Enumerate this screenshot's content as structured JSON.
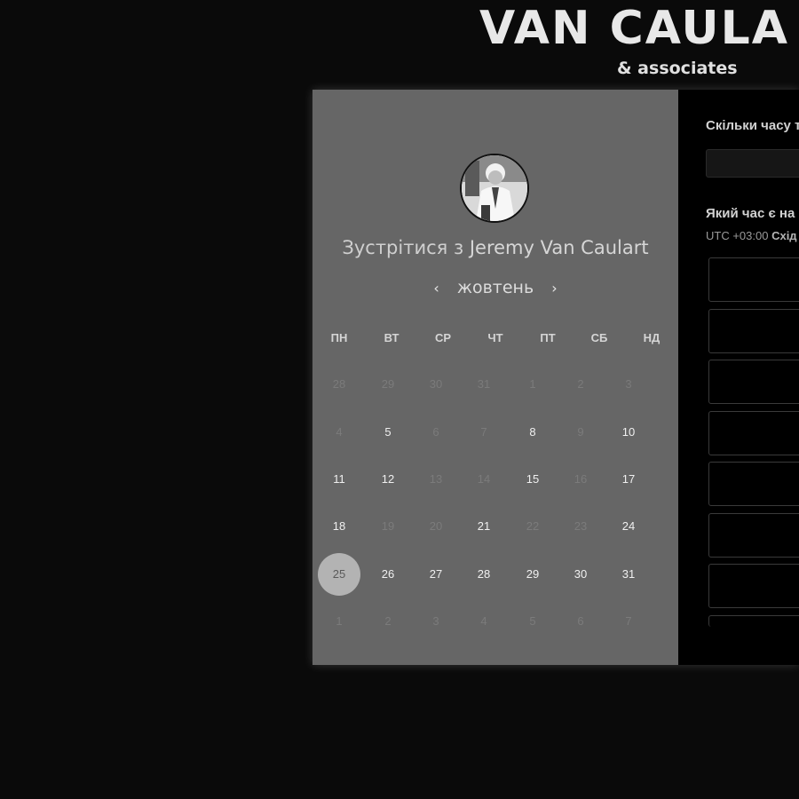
{
  "brand": {
    "name": "VAN CAULA",
    "sub": "& associates"
  },
  "booking": {
    "title_prefix": "Зустрітися з",
    "host_name": "Jeremy Van Caulart",
    "month": "жовтень",
    "prev_icon": "‹",
    "next_icon": "›",
    "weekdays": [
      "ПН",
      "ВТ",
      "СР",
      "ЧТ",
      "ПТ",
      "СБ",
      "НД"
    ],
    "weeks": [
      [
        {
          "d": "28",
          "a": false
        },
        {
          "d": "29",
          "a": false
        },
        {
          "d": "30",
          "a": false
        },
        {
          "d": "31",
          "a": false
        },
        {
          "d": "1",
          "a": false
        },
        {
          "d": "2",
          "a": false
        },
        {
          "d": "3",
          "a": false
        }
      ],
      [
        {
          "d": "4",
          "a": false
        },
        {
          "d": "5",
          "a": true
        },
        {
          "d": "6",
          "a": false
        },
        {
          "d": "7",
          "a": false
        },
        {
          "d": "8",
          "a": true
        },
        {
          "d": "9",
          "a": false
        },
        {
          "d": "10",
          "a": true
        }
      ],
      [
        {
          "d": "11",
          "a": true
        },
        {
          "d": "12",
          "a": true
        },
        {
          "d": "13",
          "a": false
        },
        {
          "d": "14",
          "a": false
        },
        {
          "d": "15",
          "a": true
        },
        {
          "d": "16",
          "a": false
        },
        {
          "d": "17",
          "a": true
        }
      ],
      [
        {
          "d": "18",
          "a": true
        },
        {
          "d": "19",
          "a": false
        },
        {
          "d": "20",
          "a": false
        },
        {
          "d": "21",
          "a": true
        },
        {
          "d": "22",
          "a": false
        },
        {
          "d": "23",
          "a": false
        },
        {
          "d": "24",
          "a": true
        }
      ],
      [
        {
          "d": "25",
          "a": true,
          "selected": true
        },
        {
          "d": "26",
          "a": true
        },
        {
          "d": "27",
          "a": true
        },
        {
          "d": "28",
          "a": true
        },
        {
          "d": "29",
          "a": true
        },
        {
          "d": "30",
          "a": true
        },
        {
          "d": "31",
          "a": true
        }
      ],
      [
        {
          "d": "1",
          "a": false
        },
        {
          "d": "2",
          "a": false
        },
        {
          "d": "3",
          "a": false
        },
        {
          "d": "4",
          "a": false
        },
        {
          "d": "5",
          "a": false
        },
        {
          "d": "6",
          "a": false
        },
        {
          "d": "7",
          "a": false
        }
      ]
    ]
  },
  "right_panel": {
    "duration_label": "Скільки часу т",
    "time_label": "Який час є на",
    "timezone_offset": "UTC +03:00",
    "timezone_name": "Схід",
    "slot_count": 8
  }
}
